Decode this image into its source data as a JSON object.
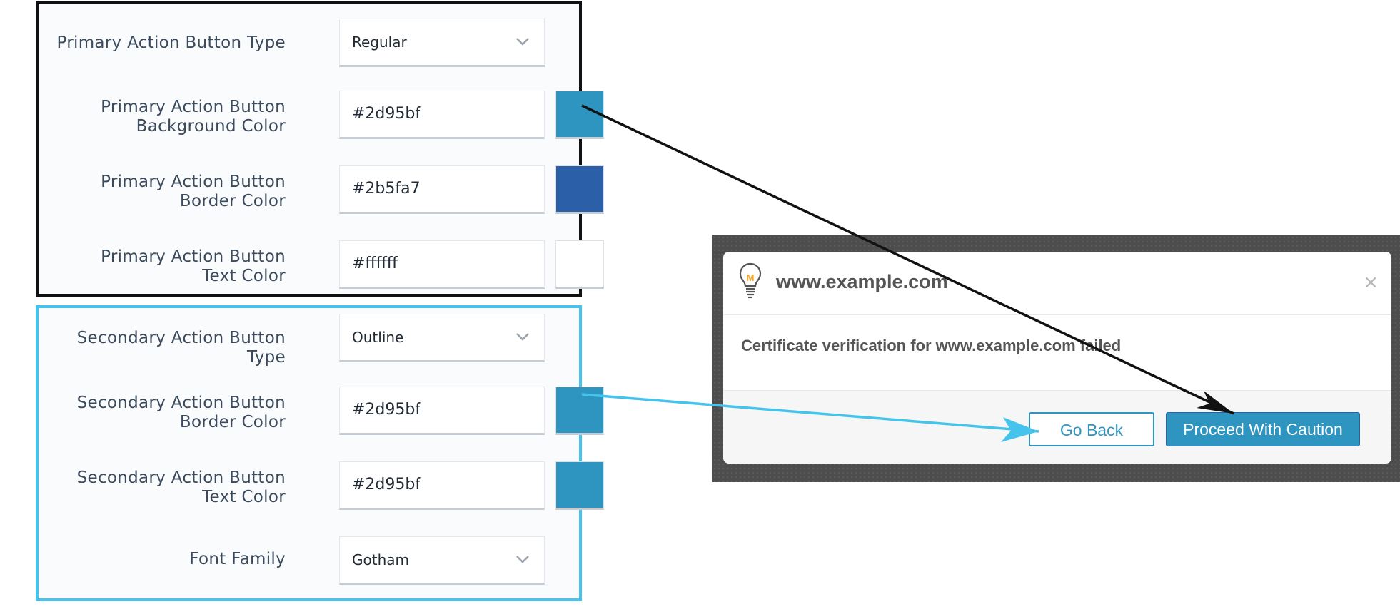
{
  "primary_panel": {
    "border_color": "#111111",
    "rows": [
      {
        "label": "Primary Action Button Type",
        "value": "Regular",
        "kind": "select"
      },
      {
        "label": "Primary Action Button Background Color",
        "value": "#2d95bf",
        "kind": "color",
        "swatch": "#2d95bf"
      },
      {
        "label": "Primary Action Button Border Color",
        "value": "#2b5fa7",
        "kind": "color",
        "swatch": "#2b5fa7"
      },
      {
        "label": "Primary Action Button Text Color",
        "value": "#ffffff",
        "kind": "color",
        "swatch": "#ffffff"
      }
    ]
  },
  "secondary_panel": {
    "border_color": "#46c3ec",
    "rows": [
      {
        "label": "Secondary Action Button Type",
        "value": "Outline",
        "kind": "select"
      },
      {
        "label": "Secondary Action Button Border Color",
        "value": "#2d95bf",
        "kind": "color",
        "swatch": "#2d95bf"
      },
      {
        "label": "Secondary Action Button Text Color",
        "value": "#2d95bf",
        "kind": "color",
        "swatch": "#2d95bf"
      },
      {
        "label": "Font Family",
        "value": "Gotham",
        "kind": "select"
      }
    ]
  },
  "dialog": {
    "title": "www.example.com",
    "icon": "lightbulb-icon",
    "icon_letter": "M",
    "close_symbol": "×",
    "message": "Certificate verification for www.example.com failed",
    "secondary_button": "Go Back",
    "primary_button": "Proceed With Caution"
  },
  "colors": {
    "accent": "#2d95bf",
    "accent_border": "#2b5fa7",
    "callout_black": "#111111",
    "callout_cyan": "#46c3ec",
    "icon_orange": "#f5a623"
  }
}
